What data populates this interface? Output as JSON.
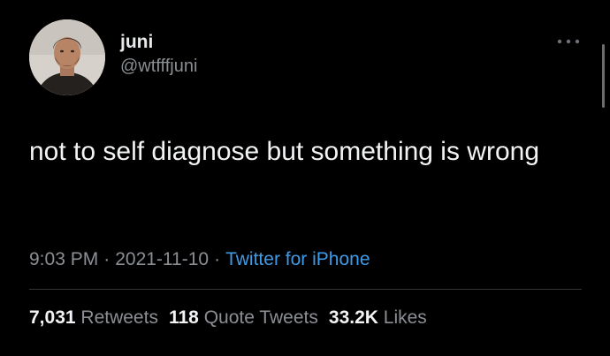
{
  "author": {
    "display_name": "juni",
    "handle": "@wtfffjuni",
    "avatar_icon": "profile-photo"
  },
  "tweet": {
    "text": "not to self diagnose but something is wrong"
  },
  "meta": {
    "time": "9:03 PM",
    "separator": "·",
    "date": "2021-11-10",
    "source": "Twitter for iPhone"
  },
  "stats": {
    "retweets_count": "7,031",
    "retweets_label": "Retweets",
    "quote_count": "118",
    "quote_label": "Quote Tweets",
    "likes_count": "33.2K",
    "likes_label": "Likes"
  },
  "icons": {
    "more": "more-options-icon"
  },
  "colors": {
    "background": "#000000",
    "primary_text": "#e7e9ea",
    "secondary_text": "#8b8f94",
    "link": "#3e9be8",
    "divider": "#2f3336"
  }
}
